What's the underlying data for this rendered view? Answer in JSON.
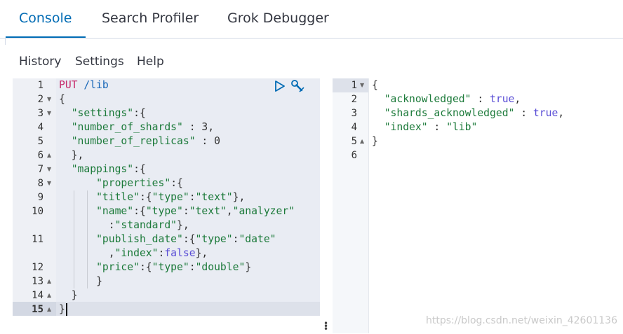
{
  "tabs": [
    {
      "label": "Console",
      "active": true
    },
    {
      "label": "Search Profiler",
      "active": false
    },
    {
      "label": "Grok Debugger",
      "active": false
    }
  ],
  "menu": {
    "history": "History",
    "settings": "Settings",
    "help": "Help"
  },
  "request_editor": {
    "line_numbers": [
      "1",
      "2",
      "3",
      "4",
      "5",
      "6",
      "7",
      "8",
      "9",
      "10",
      "",
      "11",
      "",
      "12",
      "13",
      "14",
      "15"
    ],
    "method": "PUT",
    "path": "/lib",
    "current_line": "15",
    "icons": [
      "play-icon",
      "wrench-icon"
    ]
  },
  "response_editor": {
    "line_numbers": [
      "1",
      "2",
      "3",
      "4",
      "5",
      "6"
    ],
    "lines": [
      "{",
      "\"acknowledged\"",
      "true",
      "\"shards_acknowledged\"",
      "true",
      "\"index\"",
      "\"lib\"",
      "}"
    ]
  },
  "watermark": "https://blog.csdn.net/weixin_42601136",
  "colors": {
    "active_tab": "#006bb4",
    "editor_active_bg": "#e7eaf2",
    "string": "#1c7a3a",
    "boolean": "#5a4ed6",
    "method": "#c62a6a"
  }
}
